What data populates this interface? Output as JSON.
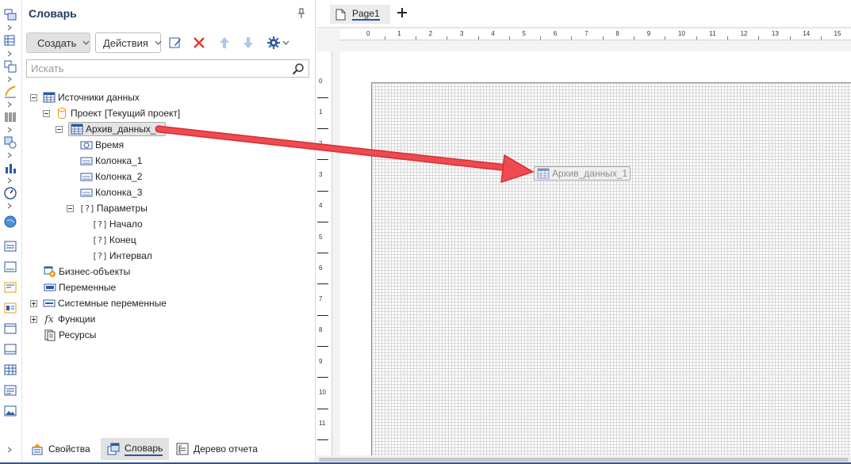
{
  "panel": {
    "title": "Словарь",
    "create_label": "Создать",
    "actions_label": "Действия",
    "search_placeholder": "Искать"
  },
  "tree": {
    "data_sources": "Источники данных",
    "project": "Проект [Текущий проект]",
    "archive": "Архив_данных_1",
    "col_time": "Время",
    "col_1": "Колонка_1",
    "col_2": "Колонка_2",
    "col_3": "Колонка_3",
    "params": "Параметры",
    "p_start": "Начало",
    "p_end": "Конец",
    "p_interval": "Интервал",
    "business": "Бизнес-объекты",
    "variables": "Переменные",
    "sys_vars": "Системные переменные",
    "functions": "Функции",
    "resources": "Ресурсы"
  },
  "bottom_tabs": {
    "properties": "Свойства",
    "dictionary": "Словарь",
    "report_tree": "Дерево отчета"
  },
  "designer": {
    "page_tab": "Page1",
    "drag_ghost": "Архив_данных_1",
    "hruler": [
      "0",
      "1",
      "2",
      "3",
      "4",
      "5",
      "6",
      "7",
      "8",
      "9",
      "10",
      "11",
      "12",
      "13",
      "14",
      "15"
    ],
    "vruler": [
      "0",
      "1",
      "2",
      "3",
      "4",
      "5",
      "6",
      "7",
      "8",
      "9",
      "10",
      "11"
    ]
  },
  "colors": {
    "accent": "#2c5aa0",
    "delete": "#e0392b",
    "arrow": "#e8343b"
  }
}
